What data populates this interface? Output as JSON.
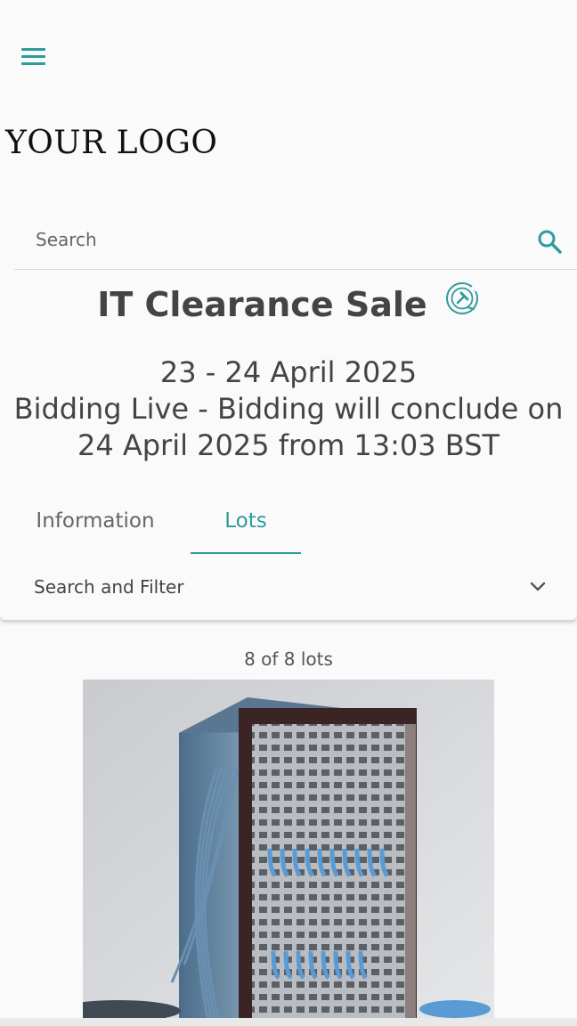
{
  "header": {
    "logo_text": "YOUR LOGO"
  },
  "search": {
    "placeholder": "Search"
  },
  "auction": {
    "title": "IT Clearance Sale",
    "date_range": "23 - 24 April 2025",
    "status_line": "Bidding Live - Bidding will conclude on",
    "conclude_line": "24 April 2025 from 13:03 BST"
  },
  "tabs": [
    {
      "label": "Information",
      "active": false
    },
    {
      "label": "Lots",
      "active": true
    }
  ],
  "filter": {
    "label": "Search and Filter"
  },
  "lots": {
    "count_text": "8 of 8 lots"
  },
  "colors": {
    "accent": "#2e9b9b",
    "text": "#444444",
    "background": "#fafafa"
  },
  "icons": [
    "menu-icon",
    "search-icon",
    "live-bidding-icon",
    "chevron-down-icon"
  ]
}
